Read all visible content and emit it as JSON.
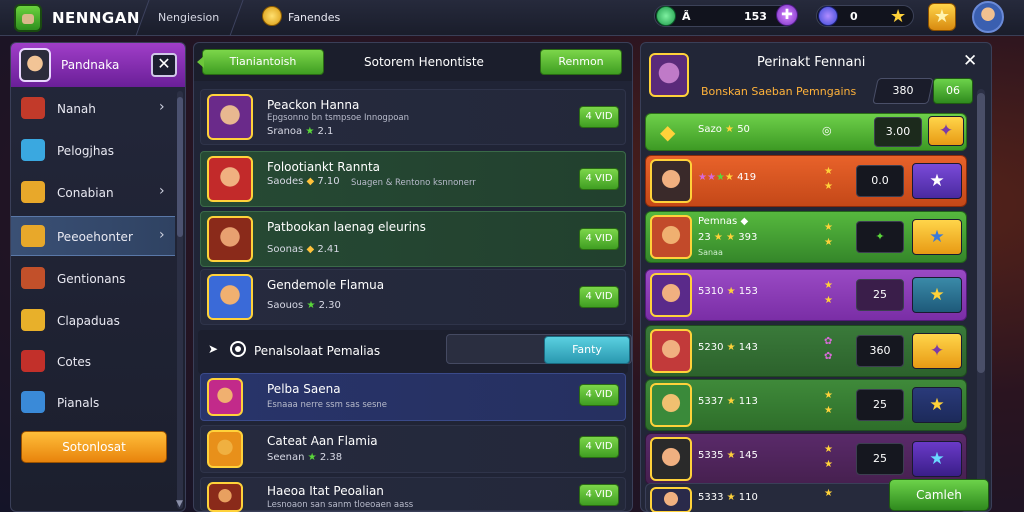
{
  "topbar": {
    "app_title": "NENNGAN",
    "sub_title": "Nengiesion",
    "coin_label": "Fanendes",
    "res1_label": "Ã",
    "res1_value": "153",
    "res2_value": "0"
  },
  "sidebar": {
    "title": "Pandnaka",
    "items": [
      {
        "label": "Nanah",
        "icon": "chest-icon",
        "color": "#c23a2a"
      },
      {
        "label": "Pelogjhas",
        "icon": "card-icon",
        "color": "#3aa8e0"
      },
      {
        "label": "Conabian",
        "icon": "crate-icon",
        "color": "#e8a82a"
      },
      {
        "label": "Peeoehonter",
        "icon": "scroll-icon",
        "color": "#e8a82a"
      },
      {
        "label": "Gentionans",
        "icon": "box-icon",
        "color": "#c2502a"
      },
      {
        "label": "Clapaduas",
        "icon": "gift-icon",
        "color": "#e8b02a"
      },
      {
        "label": "Cotes",
        "icon": "barrel-icon",
        "color": "#c2302a"
      },
      {
        "label": "Pianals",
        "icon": "gem-icon",
        "color": "#3a8ad8"
      }
    ],
    "button_label": "Sotonlosat"
  },
  "middle": {
    "tab_label": "Tianiantoish",
    "title": "Sotorem Henontiste",
    "header_button": "Renmon",
    "rows": [
      {
        "name": "Peackon Hanna",
        "desc": "Epgsonno bn tsmpsoe Innogpoan",
        "stats_pre": "Sranoa",
        "stats_num": "2.1",
        "btn": "4 VID"
      },
      {
        "name": "Folootiankt Rannta",
        "desc": "Suagen & Rentono ksnnonerr",
        "stats_pre": "Saodes",
        "stats_num": "7.10",
        "btn": "4 VID"
      },
      {
        "name": "Patbookan laenag eleurins",
        "desc": "",
        "stats_pre": "Soonas",
        "stats_num": "2.41",
        "btn": "4 VID"
      },
      {
        "name": "Gendemole Flamua",
        "desc": "",
        "stats_pre": "Saouos",
        "stats_num": "2.30",
        "btn": "4 VID"
      }
    ],
    "section_title": "Penalsolaat Pemalias",
    "section_button": "Fanty",
    "rows2": [
      {
        "name": "Pelba Saena",
        "desc": "Esnaaa nerre ssm sas sesne",
        "btn": "4 VID"
      },
      {
        "name": "Cateat Aan Flamia",
        "desc": "",
        "stats_pre": "Seenan",
        "stats_num": "2.38",
        "btn": "4 VID"
      },
      {
        "name": "Haeoa Itat Peoalian",
        "desc": "Lesnoaon san sanm tloeoaen aass",
        "btn": "4 VID"
      }
    ]
  },
  "right": {
    "title": "Perinakt Fennani",
    "subtitle": "Bonskan Saeban Pemngains",
    "value1": "380",
    "value2": "06",
    "rows": [
      {
        "text": "Sazo",
        "stat": "50",
        "box": "3.00"
      },
      {
        "text": "",
        "stat": "419",
        "box": "0.0"
      },
      {
        "text_top": "Pemnas",
        "text": "23",
        "stat": "393",
        "sub": "Sanaa"
      },
      {
        "text": "5310",
        "stat": "153",
        "box": "25"
      },
      {
        "text": "5230",
        "stat": "143",
        "box": "360"
      },
      {
        "text": "5337",
        "stat": "113",
        "box": "25"
      },
      {
        "text": "5335",
        "stat": "145",
        "box": "25"
      },
      {
        "text": "5333",
        "stat": "110",
        "box": ""
      }
    ],
    "bottom_button": "Camleh"
  }
}
